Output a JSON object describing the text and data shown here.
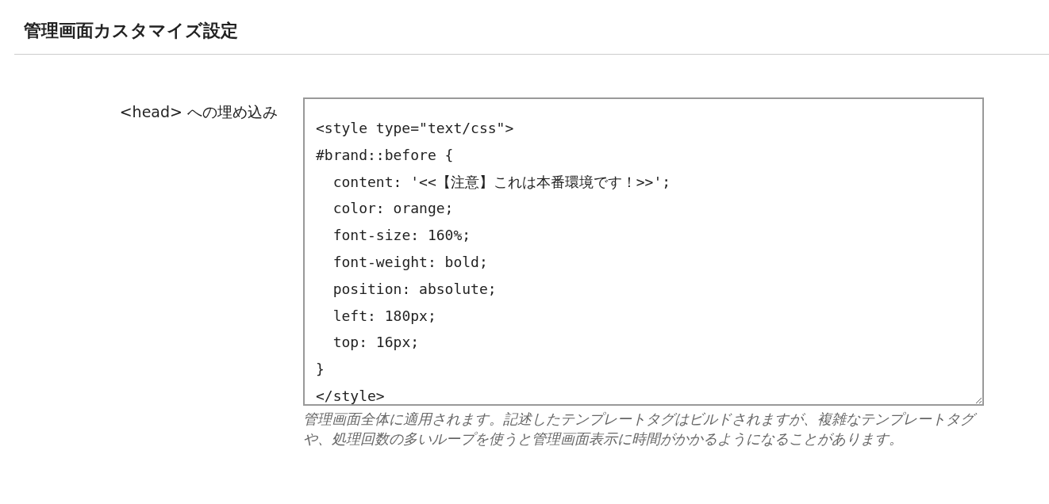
{
  "section_title": "管理画面カスタマイズ設定",
  "field": {
    "label": "<head> への埋め込み",
    "value_lines": [
      "<style type=\"text/css\">",
      "#brand::before {",
      "  content: '<<【注意】これは本番環境です！>>';",
      "  color: orange;",
      "  font-size: 160%;",
      "  font-weight: bold;",
      "  position: absolute;",
      "  left: 180px;",
      "  top: 16px;",
      "}",
      "</style>"
    ],
    "help": "管理画面全体に適用されます。記述したテンプレートタグはビルドされますが、複雑なテンプレートタグや、処理回数の多いループを使うと管理画面表示に時間がかかるようになることがあります。"
  }
}
